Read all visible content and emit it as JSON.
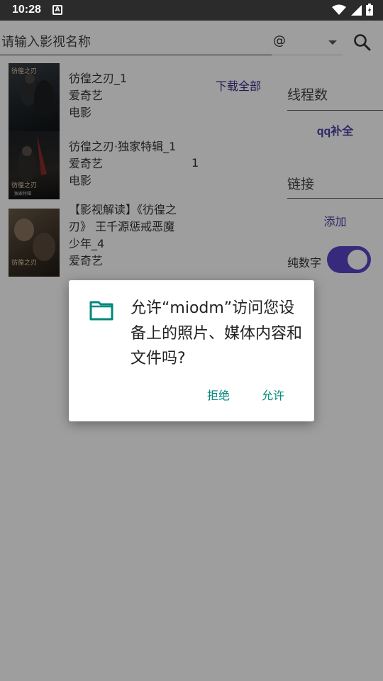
{
  "status_bar": {
    "time": "10:28",
    "notification_icon": "A"
  },
  "search": {
    "placeholder": "请输入影视名称",
    "type_value": "@"
  },
  "results": [
    {
      "title": "彷徨之刃_1",
      "source": "爱奇艺",
      "category": "电影",
      "poster_title": "彷徨之刃",
      "poster_sub": ""
    },
    {
      "title": "彷徨之刃·独家特辑_1",
      "source": "爱奇艺",
      "category": "电影",
      "poster_title": "彷徨之刃",
      "poster_sub": "独家特辑"
    },
    {
      "title_line1": "【影视解读】《彷徨之",
      "title_line2": "刃》 王千源惩戒恶魔",
      "title_line3": "少年_4",
      "source": "爱奇艺",
      "poster_title": "彷徨之刃"
    }
  ],
  "download_all_label": "下载全部",
  "count_value": "1",
  "right_panel": {
    "threads_label": "线程数",
    "qq_button_label": "qq补全",
    "link_label": "链接",
    "add_button_label": "添加",
    "numeric_label": "纯数字",
    "numeric_toggle_on": true
  },
  "dialog": {
    "message": "允许“miodm”访问您设备上的照片、媒体内容和文件吗?",
    "deny_label": "拒绝",
    "allow_label": "允许"
  },
  "colors": {
    "accent": "#5a45c8",
    "dialog_button": "#00897b",
    "folder_icon": "#00897b",
    "status_bar": "#2b2b2b"
  }
}
